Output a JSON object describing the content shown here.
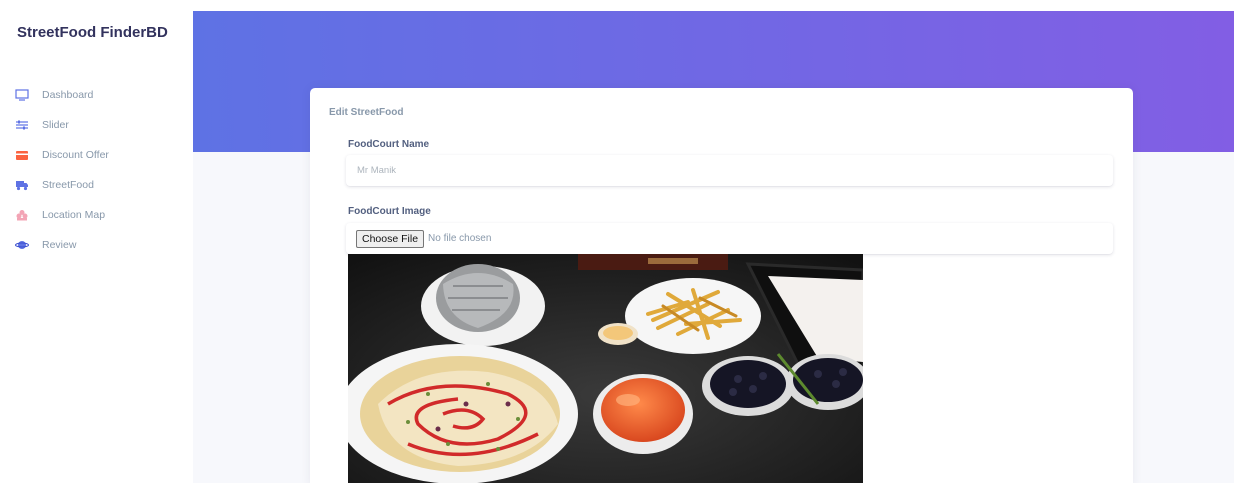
{
  "sidebar": {
    "brand": "StreetFood FinderBD",
    "items": [
      {
        "label": "Dashboard",
        "icon": "tv-icon",
        "color": "#5e72e4"
      },
      {
        "label": "Slider",
        "icon": "sliders-icon",
        "color": "#5e72e4"
      },
      {
        "label": "Discount Offer",
        "icon": "offer-card-icon",
        "color": "#fb6340"
      },
      {
        "label": "StreetFood",
        "icon": "truck-icon",
        "color": "#5e72e4"
      },
      {
        "label": "Location Map",
        "icon": "map-pin-icon",
        "color": "#f3a4b5"
      },
      {
        "label": "Review",
        "icon": "planet-icon",
        "color": "#5e72e4"
      }
    ]
  },
  "header": {
    "gradient_start": "#5e72e4",
    "gradient_end": "#825ee4"
  },
  "form": {
    "title": "Edit StreetFood",
    "name_label": "FoodCourt Name",
    "name_value": "Mr Manik",
    "image_label": "FoodCourt Image",
    "file_button": "Choose File",
    "file_status": "No file chosen"
  }
}
